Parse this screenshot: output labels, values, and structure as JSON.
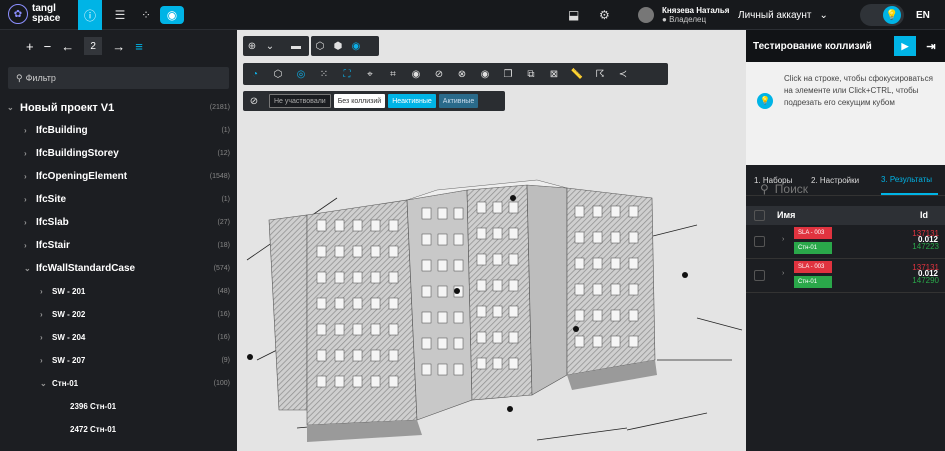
{
  "app": {
    "logo_line1": "tangl",
    "logo_line2": "space"
  },
  "topbar": {
    "user_name": "Князева Наталья",
    "user_role": "Владелец",
    "account_label": "Личный аккаунт",
    "language": "EN"
  },
  "sidebar": {
    "page_number": "2",
    "filter_placeholder": "Фильтр",
    "tree": [
      {
        "label": "Новый проект V1",
        "count": "(2181)",
        "level": 0,
        "expanded": true
      },
      {
        "label": "IfcBuilding",
        "count": "(1)",
        "level": 1
      },
      {
        "label": "IfcBuildingStorey",
        "count": "(12)",
        "level": 1
      },
      {
        "label": "IfcOpeningElement",
        "count": "(1548)",
        "level": 1
      },
      {
        "label": "IfcSite",
        "count": "(1)",
        "level": 1
      },
      {
        "label": "IfcSlab",
        "count": "(27)",
        "level": 1
      },
      {
        "label": "IfcStair",
        "count": "(18)",
        "level": 1
      },
      {
        "label": "IfcWallStandardCase",
        "count": "(574)",
        "level": 1,
        "expanded": true
      },
      {
        "label": "SW - 201",
        "count": "(48)",
        "level": 2
      },
      {
        "label": "SW - 202",
        "count": "(16)",
        "level": 2
      },
      {
        "label": "SW - 204",
        "count": "(16)",
        "level": 2
      },
      {
        "label": "SW - 207",
        "count": "(9)",
        "level": 2
      },
      {
        "label": "Стн-01",
        "count": "(100)",
        "level": 2,
        "expanded": true
      },
      {
        "label": "2396 Стн-01",
        "count": "",
        "level": 3
      },
      {
        "label": "2472 Стн-01",
        "count": "",
        "level": 3
      }
    ]
  },
  "viewport": {
    "filter_chips": [
      "Не участвовали",
      "Без коллизий",
      "Неактивные",
      "Активные"
    ]
  },
  "rpanel": {
    "title": "Тестирование коллизий",
    "info_text": "Click на строке, чтобы сфокусироваться на элементе или Click+CTRL, чтобы подрезать его секущим кубом",
    "tabs": [
      "1. Наборы",
      "2. Настройки",
      "3. Результаты"
    ],
    "search_placeholder": "Поиск",
    "col_name": "Имя",
    "col_id": "Id",
    "results": [
      {
        "a_label": "SLA - 003",
        "b_label": "Стн-01",
        "id_a": "137131",
        "id_mid": "0.012",
        "id_b": "147223"
      },
      {
        "a_label": "SLA - 003",
        "b_label": "Стн-01",
        "id_a": "137131",
        "id_mid": "0.012",
        "id_b": "147290"
      }
    ]
  },
  "colors": {
    "accent": "#00b4e6",
    "red": "#e0333f",
    "green": "#2aa84a"
  }
}
